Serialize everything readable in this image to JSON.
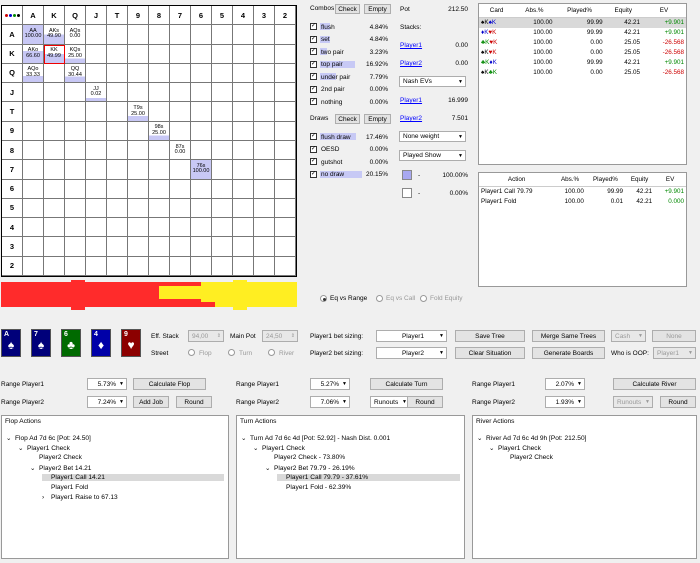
{
  "grid": {
    "ranks": [
      "A",
      "K",
      "Q",
      "J",
      "T",
      "9",
      "8",
      "7",
      "6",
      "5",
      "4",
      "3",
      "2"
    ],
    "cells": [
      {
        "row": 0,
        "col": 0,
        "label": "AA",
        "pct": "100.00"
      },
      {
        "row": 0,
        "col": 1,
        "label": "AKs",
        "pct": "49.90"
      },
      {
        "row": 0,
        "col": 2,
        "label": "AQs",
        "pct": "0.00"
      },
      {
        "row": 1,
        "col": 0,
        "label": "AKo",
        "pct": "66.60"
      },
      {
        "row": 1,
        "col": 1,
        "label": "KK",
        "pct": "49.99"
      },
      {
        "row": 1,
        "col": 2,
        "label": "KQs",
        "pct": "25.00"
      },
      {
        "row": 2,
        "col": 0,
        "label": "AQo",
        "pct": "33.33"
      },
      {
        "row": 2,
        "col": 2,
        "label": "QQ",
        "pct": "30.44"
      },
      {
        "row": 3,
        "col": 3,
        "label": "JJ",
        "pct": "0.02"
      },
      {
        "row": 4,
        "col": 5,
        "label": "T9s",
        "pct": "25.00"
      },
      {
        "row": 5,
        "col": 6,
        "label": "98s",
        "pct": "25.00"
      },
      {
        "row": 6,
        "col": 7,
        "label": "87s",
        "pct": "0.00"
      },
      {
        "row": 7,
        "col": 8,
        "label": "76s",
        "pct": "100.00"
      }
    ]
  },
  "combos": {
    "title": "Combos",
    "check_label": "Check",
    "empty_label": "Empty",
    "items": [
      {
        "label": "flush",
        "pct": "4.84%",
        "bar": 4.84
      },
      {
        "label": "set",
        "pct": "4.84%",
        "bar": 4.84
      },
      {
        "label": "two pair",
        "pct": "3.23%",
        "bar": 3.23
      },
      {
        "label": "top pair",
        "pct": "16.92%",
        "bar": 16.92
      },
      {
        "label": "under pair",
        "pct": "7.79%",
        "bar": 7.79
      },
      {
        "label": "2nd pair",
        "pct": "0.00%",
        "bar": 0
      },
      {
        "label": "nothing",
        "pct": "0.00%",
        "bar": 0
      }
    ]
  },
  "draws": {
    "title": "Draws",
    "check_label": "Check",
    "empty_label": "Empty",
    "items": [
      {
        "label": "flush draw",
        "pct": "17.46%",
        "bar": 17.46
      },
      {
        "label": "OESD",
        "pct": "0.00%",
        "bar": 0
      },
      {
        "label": "gutshot",
        "pct": "0.00%",
        "bar": 0
      },
      {
        "label": "no draw",
        "pct": "20.15%",
        "bar": 20.15
      }
    ]
  },
  "pot": {
    "label": "Pot",
    "value": "212.50",
    "stacks_label": "Stacks:",
    "player1": "Player1",
    "player1_stack": "0.00",
    "player2": "Player2",
    "player2_stack": "0.00",
    "ev_select": "Nash EVs",
    "player1_ev": "16.999",
    "player2_ev": "7.501",
    "weight_select": "None weight",
    "show_select": "Played Show",
    "legend1": "100.00%",
    "legend2": "0.00%",
    "legend_dash": "-"
  },
  "cards_table": {
    "headers": [
      "Card",
      "Abs.%",
      "Played%",
      "Equity",
      "EV"
    ],
    "rows": [
      {
        "c1": "♠",
        "r1": "K",
        "c2": "♠",
        "r2": "K",
        "s1": "black",
        "s2": "blue",
        "abs": "100.00",
        "played": "99.99",
        "equity": "42.21",
        "ev": "+9.901",
        "neg": false,
        "sel": true
      },
      {
        "c1": "♦",
        "r1": "K",
        "c2": "♥",
        "r2": "K",
        "s1": "blue",
        "s2": "red",
        "abs": "100.00",
        "played": "99.99",
        "equity": "42.21",
        "ev": "+9.901",
        "neg": false,
        "sel": false
      },
      {
        "c1": "♣",
        "r1": "K",
        "c2": "♥",
        "r2": "K",
        "s1": "green",
        "s2": "red",
        "abs": "100.00",
        "played": "0.00",
        "equity": "25.05",
        "ev": "-26.568",
        "neg": true,
        "sel": false
      },
      {
        "c1": "♠",
        "r1": "K",
        "c2": "♥",
        "r2": "K",
        "s1": "black",
        "s2": "red",
        "abs": "100.00",
        "played": "0.00",
        "equity": "25.05",
        "ev": "-26.568",
        "neg": true,
        "sel": false
      },
      {
        "c1": "♣",
        "r1": "K",
        "c2": "♦",
        "r2": "K",
        "s1": "green",
        "s2": "blue",
        "abs": "100.00",
        "played": "99.99",
        "equity": "42.21",
        "ev": "+9.901",
        "neg": false,
        "sel": false
      },
      {
        "c1": "♠",
        "r1": "K",
        "c2": "♣",
        "r2": "K",
        "s1": "black",
        "s2": "green",
        "abs": "100.00",
        "played": "0.00",
        "equity": "25.05",
        "ev": "-26.568",
        "neg": true,
        "sel": false
      }
    ]
  },
  "action_table": {
    "headers": [
      "Action",
      "Abs.%",
      "Played%",
      "Equity",
      "EV"
    ],
    "rows": [
      {
        "action": "Player1 Call 79.79",
        "abs": "100.00",
        "played": "99.99",
        "equity": "42.21",
        "ev": "+9.901",
        "neg": false
      },
      {
        "action": "Player1 Fold",
        "abs": "100.00",
        "played": "0.01",
        "equity": "42.21",
        "ev": "0.000",
        "neg": false
      }
    ]
  },
  "equity_mode": {
    "options": [
      "Eq vs Range",
      "Eq vs Call",
      "Fold Equity"
    ],
    "selected": 0
  },
  "board": {
    "cards": [
      {
        "rank": "A",
        "suit": "♠",
        "color": "#00007a"
      },
      {
        "rank": "7",
        "suit": "♠",
        "color": "#00007a"
      },
      {
        "rank": "6",
        "suit": "♣",
        "color": "#006a00"
      },
      {
        "rank": "4",
        "suit": "♦",
        "color": "#0000a8"
      },
      {
        "rank": "9",
        "suit": "♥",
        "color": "#8c0000"
      }
    ]
  },
  "controls": {
    "eff_stack_label": "Eff. Stack",
    "eff_stack": "94,00",
    "main_pot_label": "Main Pot",
    "main_pot": "24,50",
    "street_label": "Street",
    "streets": [
      "Flop",
      "Turn",
      "River"
    ],
    "p1_sizing_label": "Player1 bet sizing:",
    "p1_sizing": "Player1",
    "p2_sizing_label": "Player2 bet sizing:",
    "p2_sizing": "Player2",
    "save_tree": "Save Tree",
    "merge_trees": "Merge Same Trees",
    "cash": "Cash",
    "none": "None",
    "clear_situation": "Clear Situation",
    "generate_boards": "Generate Boards",
    "who_oop_label": "Who is OOP:",
    "who_oop": "Player1"
  },
  "ranges": {
    "flop": {
      "p1_label": "Range Player1",
      "p1": "5.73%",
      "p2_label": "Range Player2",
      "p2": "7.24%",
      "calc": "Calculate Flop",
      "add_job": "Add Job",
      "round": "Round"
    },
    "turn": {
      "p1_label": "Range Player1",
      "p1": "5.27%",
      "p2_label": "Range Player2",
      "p2": "7.06%",
      "calc": "Calculate Turn",
      "runouts": "Runouts",
      "round": "Round"
    },
    "river": {
      "p1_label": "Range Player1",
      "p1": "2.07%",
      "p2_label": "Range Player2",
      "p2": "1.93%",
      "calc": "Calculate River",
      "runouts": "Runouts",
      "round": "Round"
    }
  },
  "flop_tree": {
    "title": "Flop Actions",
    "nodes": [
      {
        "text": "Flop Ad 7d 6c [Pot: 24.50]",
        "indent": 0,
        "arrow": "⌄",
        "sel": false
      },
      {
        "text": "Player1 Check",
        "indent": 1,
        "arrow": "⌄",
        "sel": false
      },
      {
        "text": "Player2 Check",
        "indent": 2,
        "arrow": "",
        "sel": false
      },
      {
        "text": "Player2 Bet 14.21",
        "indent": 2,
        "arrow": "⌄",
        "sel": false
      },
      {
        "text": "Player1 Call 14.21",
        "indent": 3,
        "arrow": "",
        "sel": true
      },
      {
        "text": "Player1 Fold",
        "indent": 3,
        "arrow": "",
        "sel": false
      },
      {
        "text": "Player1 Raise to 67.13",
        "indent": 3,
        "arrow": "›",
        "sel": false
      }
    ]
  },
  "turn_tree": {
    "title": "Turn Actions",
    "nodes": [
      {
        "text": "Turn Ad 7d 6c 4d [Pot: 52.92] - Nash Dist. 0.001",
        "indent": 0,
        "arrow": "⌄",
        "sel": false
      },
      {
        "text": "Player1 Check",
        "indent": 1,
        "arrow": "⌄",
        "sel": false
      },
      {
        "text": "Player2 Check - 73.80%",
        "indent": 2,
        "arrow": "",
        "sel": false
      },
      {
        "text": "Player2 Bet 79.79 - 26.19%",
        "indent": 2,
        "arrow": "⌄",
        "sel": false
      },
      {
        "text": "Player1 Call 79.79 - 37.61%",
        "indent": 3,
        "arrow": "",
        "sel": true
      },
      {
        "text": "Player1 Fold - 62.39%",
        "indent": 3,
        "arrow": "",
        "sel": false
      }
    ]
  },
  "river_tree": {
    "title": "River Actions",
    "nodes": [
      {
        "text": "River Ad 7d 6c 4d 9h [Pot: 212.50]",
        "indent": 0,
        "arrow": "⌄",
        "sel": false
      },
      {
        "text": "Player1 Check",
        "indent": 1,
        "arrow": "⌄",
        "sel": false
      },
      {
        "text": "Player2 Check",
        "indent": 2,
        "arrow": "",
        "sel": false
      }
    ]
  }
}
